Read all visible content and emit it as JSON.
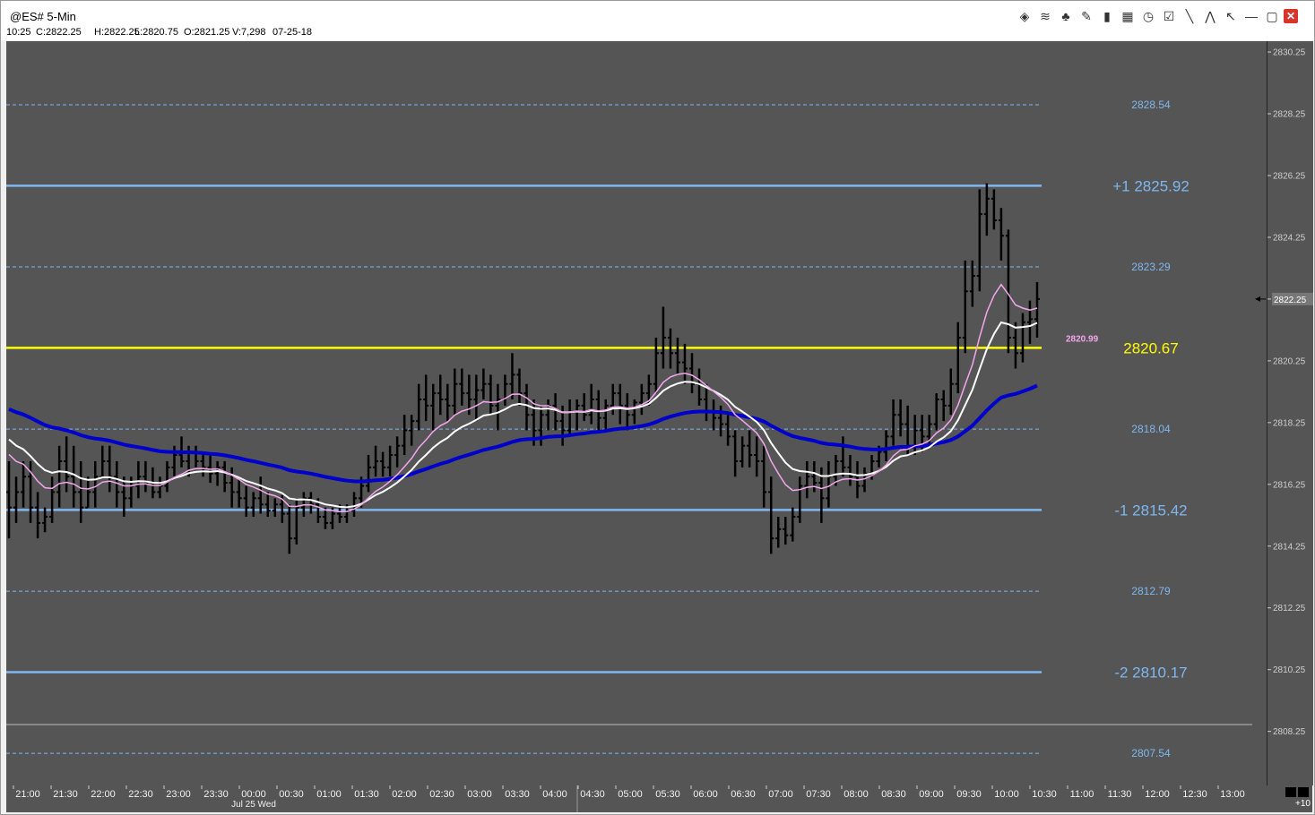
{
  "window": {
    "title": "@ES# 5-Min",
    "toolbar_icons": [
      "chart-icon",
      "pivot-icon",
      "tree-icon",
      "pencil-icon",
      "bar-chart-icon",
      "list-icon",
      "clock-icon",
      "checklist-icon",
      "line-icon",
      "zigzag-icon",
      "pointer-icon",
      "minimize-icon",
      "maximize-icon",
      "close-icon"
    ],
    "toolbar_glyphs": [
      "◈",
      "≋",
      "♣",
      "✎",
      "▮",
      "▦",
      "◷",
      "☑",
      "╲",
      "⋀",
      "↖",
      "—",
      "▢",
      "✕"
    ]
  },
  "infobar": {
    "time": "10:25",
    "close": "C:2822.25",
    "high": "H:2822.25",
    "low": "L:2820.75",
    "open": "O:2821.25",
    "volume": "V:7,298",
    "date": "07-25-18"
  },
  "colors": {
    "background": "#555555",
    "pivot": "#ffff00",
    "sigma": "#7fb8f0",
    "ema_blue": "#0000cc",
    "ema_pink": "#f4a6ee",
    "ema_white": "#ffffff",
    "bars": "#000000"
  },
  "chart_data": {
    "type": "ohlc",
    "symbol": "@ES#",
    "interval": "5-Min",
    "ylim": [
      2806.5,
      2830.6
    ],
    "y_ticks": [
      2830.25,
      2828.25,
      2826.25,
      2824.25,
      2822.25,
      2820.25,
      2818.25,
      2816.25,
      2814.25,
      2812.25,
      2810.25,
      2808.25
    ],
    "last_price": 2822.25,
    "x_ticks": [
      "21:00",
      "21:30",
      "22:00",
      "22:30",
      "23:00",
      "23:30",
      "00:00",
      "00:30",
      "01:00",
      "01:30",
      "02:00",
      "02:30",
      "03:00",
      "03:30",
      "04:00",
      "04:30",
      "05:00",
      "05:30",
      "06:00",
      "06:30",
      "07:00",
      "07:30",
      "08:00",
      "08:30",
      "09:00",
      "09:30",
      "10:00",
      "10:30",
      "11:00",
      "11:30",
      "12:00",
      "12:30",
      "13:00"
    ],
    "x_subtick": "Jul 25 Wed",
    "levels": [
      {
        "label": "2828.54",
        "value": 2828.54,
        "style": "dashed"
      },
      {
        "label": "+1 2825.92",
        "value": 2825.92,
        "style": "solid"
      },
      {
        "label": "2823.29",
        "value": 2823.29,
        "style": "dashed"
      },
      {
        "label": "2820.67",
        "value": 2820.67,
        "style": "pivot"
      },
      {
        "label": "2818.04",
        "value": 2818.04,
        "style": "dashed"
      },
      {
        "label": "-1 2815.42",
        "value": 2815.42,
        "style": "solid"
      },
      {
        "label": "2812.79",
        "value": 2812.79,
        "style": "dashed"
      },
      {
        "label": "-2 2810.17",
        "value": 2810.17,
        "style": "solid"
      },
      {
        "label": "2807.54",
        "value": 2807.54,
        "style": "dashed"
      }
    ],
    "ema_label": "2820.99",
    "ema_label_value": 2820.99,
    "bars": [
      [
        2816.0,
        2817.0,
        2814.5,
        2815.5
      ],
      [
        2815.5,
        2816.5,
        2815.0,
        2816.0
      ],
      [
        2816.0,
        2817.0,
        2815.5,
        2816.5
      ],
      [
        2816.5,
        2817.0,
        2815.0,
        2815.5
      ],
      [
        2815.5,
        2816.0,
        2814.5,
        2815.0
      ],
      [
        2815.0,
        2815.5,
        2814.7,
        2815.2
      ],
      [
        2815.2,
        2816.5,
        2815.0,
        2816.0
      ],
      [
        2816.0,
        2817.5,
        2815.5,
        2817.0
      ],
      [
        2817.0,
        2817.8,
        2816.0,
        2816.5
      ],
      [
        2816.5,
        2817.5,
        2815.5,
        2816.0
      ],
      [
        2816.0,
        2817.0,
        2815.0,
        2815.5
      ],
      [
        2815.5,
        2816.5,
        2815.5,
        2816.0
      ],
      [
        2816.0,
        2817.0,
        2815.5,
        2816.5
      ],
      [
        2816.5,
        2817.5,
        2816.5,
        2817.0
      ],
      [
        2817.0,
        2817.5,
        2816.0,
        2816.5
      ],
      [
        2816.5,
        2817.0,
        2815.5,
        2816.0
      ],
      [
        2816.0,
        2816.5,
        2815.2,
        2815.8
      ],
      [
        2815.8,
        2816.5,
        2815.5,
        2816.2
      ],
      [
        2816.2,
        2817.0,
        2815.8,
        2816.5
      ],
      [
        2816.5,
        2817.0,
        2816.0,
        2816.3
      ],
      [
        2816.3,
        2816.8,
        2815.8,
        2816.0
      ],
      [
        2816.0,
        2816.5,
        2815.8,
        2816.2
      ],
      [
        2816.2,
        2817.0,
        2816.0,
        2816.8
      ],
      [
        2816.8,
        2817.5,
        2816.5,
        2817.2
      ],
      [
        2817.2,
        2817.8,
        2816.8,
        2817.0
      ],
      [
        2817.0,
        2817.5,
        2816.5,
        2817.3
      ],
      [
        2817.3,
        2817.5,
        2816.8,
        2817.0
      ],
      [
        2817.0,
        2817.3,
        2816.5,
        2816.8
      ],
      [
        2816.8,
        2817.2,
        2816.3,
        2816.6
      ],
      [
        2816.6,
        2817.0,
        2816.2,
        2816.8
      ],
      [
        2816.8,
        2817.0,
        2816.0,
        2816.3
      ],
      [
        2816.3,
        2816.8,
        2815.5,
        2816.0
      ],
      [
        2816.0,
        2816.5,
        2815.5,
        2815.8
      ],
      [
        2815.8,
        2816.2,
        2815.2,
        2815.5
      ],
      [
        2815.5,
        2816.0,
        2815.2,
        2815.8
      ],
      [
        2815.8,
        2816.5,
        2815.3,
        2815.6
      ],
      [
        2815.6,
        2816.0,
        2815.2,
        2815.4
      ],
      [
        2815.4,
        2815.8,
        2815.2,
        2815.6
      ],
      [
        2815.6,
        2815.9,
        2815.0,
        2815.3
      ],
      [
        2815.3,
        2815.6,
        2814.0,
        2814.5
      ],
      [
        2814.5,
        2815.8,
        2814.3,
        2815.5
      ],
      [
        2815.5,
        2816.0,
        2815.2,
        2815.8
      ],
      [
        2815.8,
        2816.0,
        2815.3,
        2815.6
      ],
      [
        2815.6,
        2815.8,
        2815.0,
        2815.2
      ],
      [
        2815.2,
        2815.5,
        2814.8,
        2815.0
      ],
      [
        2815.0,
        2815.5,
        2814.8,
        2815.3
      ],
      [
        2815.3,
        2815.6,
        2815.0,
        2815.2
      ],
      [
        2815.2,
        2815.6,
        2815.0,
        2815.4
      ],
      [
        2815.4,
        2816.0,
        2815.2,
        2815.8
      ],
      [
        2815.8,
        2816.5,
        2815.5,
        2816.2
      ],
      [
        2816.2,
        2817.2,
        2816.0,
        2816.8
      ],
      [
        2816.8,
        2817.5,
        2816.5,
        2817.0
      ],
      [
        2817.0,
        2817.3,
        2816.5,
        2816.8
      ],
      [
        2816.8,
        2817.5,
        2816.5,
        2817.2
      ],
      [
        2817.2,
        2817.8,
        2816.8,
        2817.5
      ],
      [
        2817.5,
        2818.5,
        2817.2,
        2818.0
      ],
      [
        2818.0,
        2818.5,
        2817.5,
        2818.3
      ],
      [
        2818.3,
        2819.5,
        2818.0,
        2819.0
      ],
      [
        2819.0,
        2819.8,
        2818.3,
        2818.8
      ],
      [
        2818.8,
        2819.5,
        2818.0,
        2819.2
      ],
      [
        2819.2,
        2819.8,
        2818.5,
        2819.0
      ],
      [
        2819.0,
        2819.5,
        2818.3,
        2818.8
      ],
      [
        2818.8,
        2820.0,
        2818.5,
        2819.5
      ],
      [
        2819.5,
        2820.0,
        2818.8,
        2819.2
      ],
      [
        2819.2,
        2819.8,
        2818.5,
        2819.0
      ],
      [
        2819.0,
        2819.8,
        2818.3,
        2819.3
      ],
      [
        2819.3,
        2820.0,
        2819.0,
        2819.5
      ],
      [
        2819.5,
        2819.8,
        2818.5,
        2818.8
      ],
      [
        2818.8,
        2819.5,
        2818.0,
        2819.0
      ],
      [
        2819.0,
        2819.8,
        2818.8,
        2819.5
      ],
      [
        2819.5,
        2820.5,
        2819.0,
        2819.8
      ],
      [
        2819.8,
        2820.0,
        2818.8,
        2819.2
      ],
      [
        2819.2,
        2819.5,
        2818.0,
        2818.5
      ],
      [
        2818.5,
        2819.0,
        2817.5,
        2818.0
      ],
      [
        2818.0,
        2818.8,
        2817.5,
        2818.5
      ],
      [
        2818.5,
        2819.0,
        2818.0,
        2818.8
      ],
      [
        2818.8,
        2819.2,
        2818.0,
        2818.3
      ],
      [
        2818.3,
        2818.8,
        2817.5,
        2818.0
      ],
      [
        2818.0,
        2819.0,
        2817.8,
        2818.6
      ],
      [
        2818.6,
        2819.0,
        2818.0,
        2818.8
      ],
      [
        2818.8,
        2819.2,
        2818.3,
        2818.5
      ],
      [
        2818.5,
        2819.5,
        2818.2,
        2819.0
      ],
      [
        2819.0,
        2819.3,
        2818.0,
        2818.4
      ],
      [
        2818.4,
        2819.0,
        2818.0,
        2818.8
      ],
      [
        2818.8,
        2819.5,
        2818.5,
        2819.2
      ],
      [
        2819.2,
        2819.5,
        2818.2,
        2818.8
      ],
      [
        2818.8,
        2819.2,
        2818.0,
        2818.5
      ],
      [
        2818.5,
        2819.0,
        2818.2,
        2818.9
      ],
      [
        2818.9,
        2819.5,
        2818.5,
        2819.2
      ],
      [
        2819.2,
        2819.8,
        2818.8,
        2819.5
      ],
      [
        2819.5,
        2821.0,
        2819.2,
        2820.5
      ],
      [
        2820.5,
        2822.0,
        2820.0,
        2821.0
      ],
      [
        2821.0,
        2821.3,
        2820.0,
        2820.5
      ],
      [
        2820.5,
        2821.0,
        2819.8,
        2820.2
      ],
      [
        2820.2,
        2820.8,
        2819.5,
        2820.0
      ],
      [
        2820.0,
        2820.5,
        2819.2,
        2819.5
      ],
      [
        2819.5,
        2820.0,
        2818.8,
        2819.0
      ],
      [
        2819.0,
        2819.5,
        2818.3,
        2818.6
      ],
      [
        2818.6,
        2819.0,
        2818.0,
        2818.4
      ],
      [
        2818.4,
        2818.8,
        2817.8,
        2818.2
      ],
      [
        2818.2,
        2818.5,
        2817.5,
        2817.8
      ],
      [
        2817.8,
        2818.0,
        2816.5,
        2817.0
      ],
      [
        2817.0,
        2817.8,
        2816.8,
        2817.5
      ],
      [
        2817.5,
        2818.0,
        2816.8,
        2817.2
      ],
      [
        2817.2,
        2817.8,
        2816.5,
        2817.0
      ],
      [
        2817.0,
        2817.5,
        2815.5,
        2816.0
      ],
      [
        2816.0,
        2816.5,
        2814.0,
        2814.5
      ],
      [
        2814.5,
        2815.2,
        2814.2,
        2814.8
      ],
      [
        2814.8,
        2815.2,
        2814.3,
        2814.6
      ],
      [
        2814.6,
        2815.5,
        2814.4,
        2815.2
      ],
      [
        2815.2,
        2816.5,
        2815.0,
        2816.2
      ],
      [
        2816.2,
        2817.0,
        2815.8,
        2816.5
      ],
      [
        2816.5,
        2817.0,
        2816.0,
        2816.3
      ],
      [
        2816.3,
        2816.8,
        2815.0,
        2815.8
      ],
      [
        2815.8,
        2817.0,
        2815.5,
        2816.5
      ],
      [
        2816.5,
        2817.2,
        2816.2,
        2817.0
      ],
      [
        2817.0,
        2817.8,
        2816.5,
        2816.8
      ],
      [
        2816.8,
        2817.2,
        2816.2,
        2816.5
      ],
      [
        2816.5,
        2817.0,
        2815.8,
        2816.2
      ],
      [
        2816.2,
        2816.8,
        2816.0,
        2816.6
      ],
      [
        2816.6,
        2817.2,
        2816.4,
        2817.0
      ],
      [
        2817.0,
        2817.5,
        2816.8,
        2817.3
      ],
      [
        2817.3,
        2818.0,
        2817.0,
        2817.8
      ],
      [
        2817.8,
        2819.0,
        2817.5,
        2818.5
      ],
      [
        2818.5,
        2819.0,
        2817.8,
        2818.2
      ],
      [
        2818.2,
        2818.8,
        2817.2,
        2817.5
      ],
      [
        2817.5,
        2818.5,
        2817.2,
        2818.0
      ],
      [
        2818.0,
        2818.5,
        2817.3,
        2817.8
      ],
      [
        2817.8,
        2818.5,
        2817.5,
        2818.2
      ],
      [
        2818.2,
        2819.2,
        2818.0,
        2819.0
      ],
      [
        2819.0,
        2819.3,
        2818.3,
        2818.8
      ],
      [
        2818.8,
        2820.0,
        2818.5,
        2819.5
      ],
      [
        2819.5,
        2821.5,
        2819.2,
        2821.0
      ],
      [
        2821.0,
        2823.5,
        2820.5,
        2822.5
      ],
      [
        2822.5,
        2823.5,
        2822.0,
        2823.0
      ],
      [
        2823.0,
        2825.8,
        2822.5,
        2825.0
      ],
      [
        2825.0,
        2826.0,
        2824.3,
        2825.5
      ],
      [
        2825.5,
        2825.8,
        2824.5,
        2824.8
      ],
      [
        2824.8,
        2825.2,
        2823.5,
        2824.3
      ],
      [
        2824.3,
        2824.5,
        2820.5,
        2821.0
      ],
      [
        2821.0,
        2821.5,
        2820.0,
        2820.5
      ],
      [
        2820.5,
        2821.8,
        2820.2,
        2821.5
      ],
      [
        2821.5,
        2822.2,
        2820.8,
        2821.6
      ],
      [
        2821.6,
        2822.8,
        2821.0,
        2822.25
      ]
    ]
  }
}
